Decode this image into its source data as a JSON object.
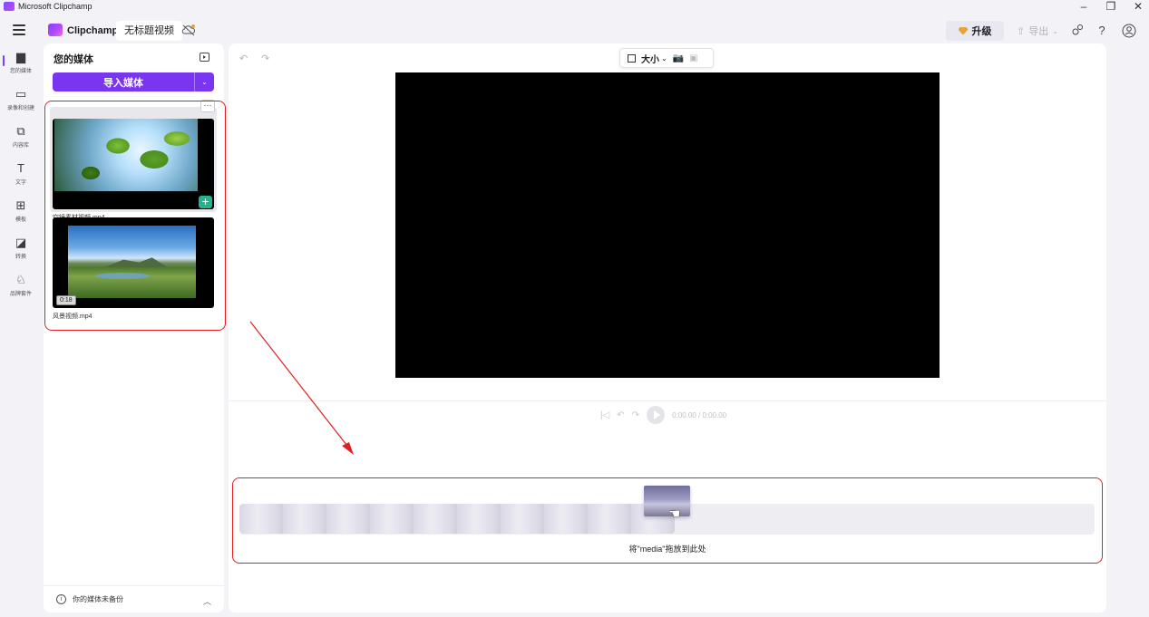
{
  "window": {
    "title": "Microsoft Clipchamp",
    "controls": [
      "–",
      "❐",
      "✕"
    ]
  },
  "appbar": {
    "brand": "Clipchamp",
    "project_name": "无标题视频",
    "upgrade_label": "升级",
    "export_label": "导出",
    "help_icon": "?"
  },
  "rail": {
    "items": [
      {
        "label": "您的媒体",
        "icon": "folder-icon",
        "glyph": "▆"
      },
      {
        "label": "录像和创建",
        "icon": "camera-icon",
        "glyph": "▭"
      },
      {
        "label": "内容库",
        "icon": "library-icon",
        "glyph": "⧉"
      },
      {
        "label": "文字",
        "icon": "text-icon",
        "glyph": "T"
      },
      {
        "label": "模板",
        "icon": "template-icon",
        "glyph": "⊞"
      },
      {
        "label": "转换",
        "icon": "transition-icon",
        "glyph": "◪"
      },
      {
        "label": "品牌套件",
        "icon": "brand-kit-icon",
        "glyph": "♘"
      }
    ]
  },
  "media_panel": {
    "title": "您的媒体",
    "import_label": "导入媒体",
    "items": [
      {
        "filename": "空镜素材视频.mp4",
        "more_label": "···",
        "add_label": "+"
      },
      {
        "filename": "风景视频.mp4",
        "duration": "0:18"
      }
    ],
    "backup_note": "你的媒体未备份"
  },
  "stage": {
    "size_label": "大小",
    "timecode": "0:00.00 / 0:00.00",
    "drop_hint": "将\"media\"拖放到此处"
  }
}
